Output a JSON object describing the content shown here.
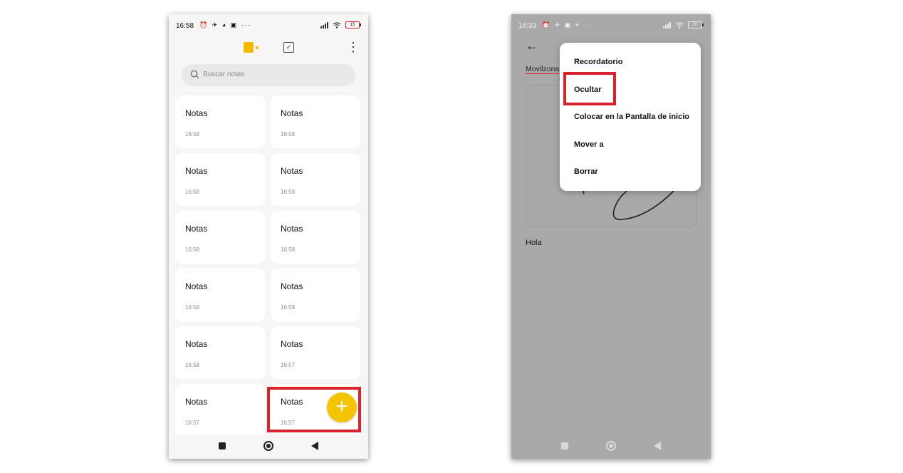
{
  "left_phone": {
    "status": {
      "time": "16:58",
      "extra_icons": "⏰ ✈ ◕ ▣ ···",
      "battery": "15"
    },
    "search": {
      "placeholder": "Buscar notas"
    },
    "notes": [
      {
        "title": "Notas",
        "time": "16:58"
      },
      {
        "title": "Notas",
        "time": "16:58"
      },
      {
        "title": "Notas",
        "time": "16:58"
      },
      {
        "title": "Notas",
        "time": "16:58"
      },
      {
        "title": "Notas",
        "time": "16:58"
      },
      {
        "title": "Notas",
        "time": "16:58"
      },
      {
        "title": "Notas",
        "time": "16:58"
      },
      {
        "title": "Notas",
        "time": "16:58"
      },
      {
        "title": "Notas",
        "time": "16:58"
      },
      {
        "title": "Notas",
        "time": "16:57"
      },
      {
        "title": "Notas",
        "time": "16:57"
      },
      {
        "title": "Notas",
        "time": "16:57"
      }
    ],
    "fab_symbol": "+",
    "icons": [
      "folder-icon",
      "task-icon",
      "more-icon",
      "search-icon",
      "add-icon"
    ]
  },
  "right_phone": {
    "status": {
      "time": "16:33",
      "extra_icons": "⏰ ✈ ▣ ⌖ ··",
      "battery": "20"
    },
    "note_title_partial": "Movilzona",
    "note_body": "Hola",
    "menu_items": [
      "Recordatorio",
      "Ocultar",
      "Colocar en la Pantalla de inicio",
      "Mover a",
      "Borrar"
    ],
    "highlighted_item": "Ocultar"
  },
  "colors": {
    "accent_yellow": "#f5c400",
    "highlight_red": "#d8232f",
    "dim_overlay": "#a9a9a9",
    "card_bg": "#ffffff"
  }
}
